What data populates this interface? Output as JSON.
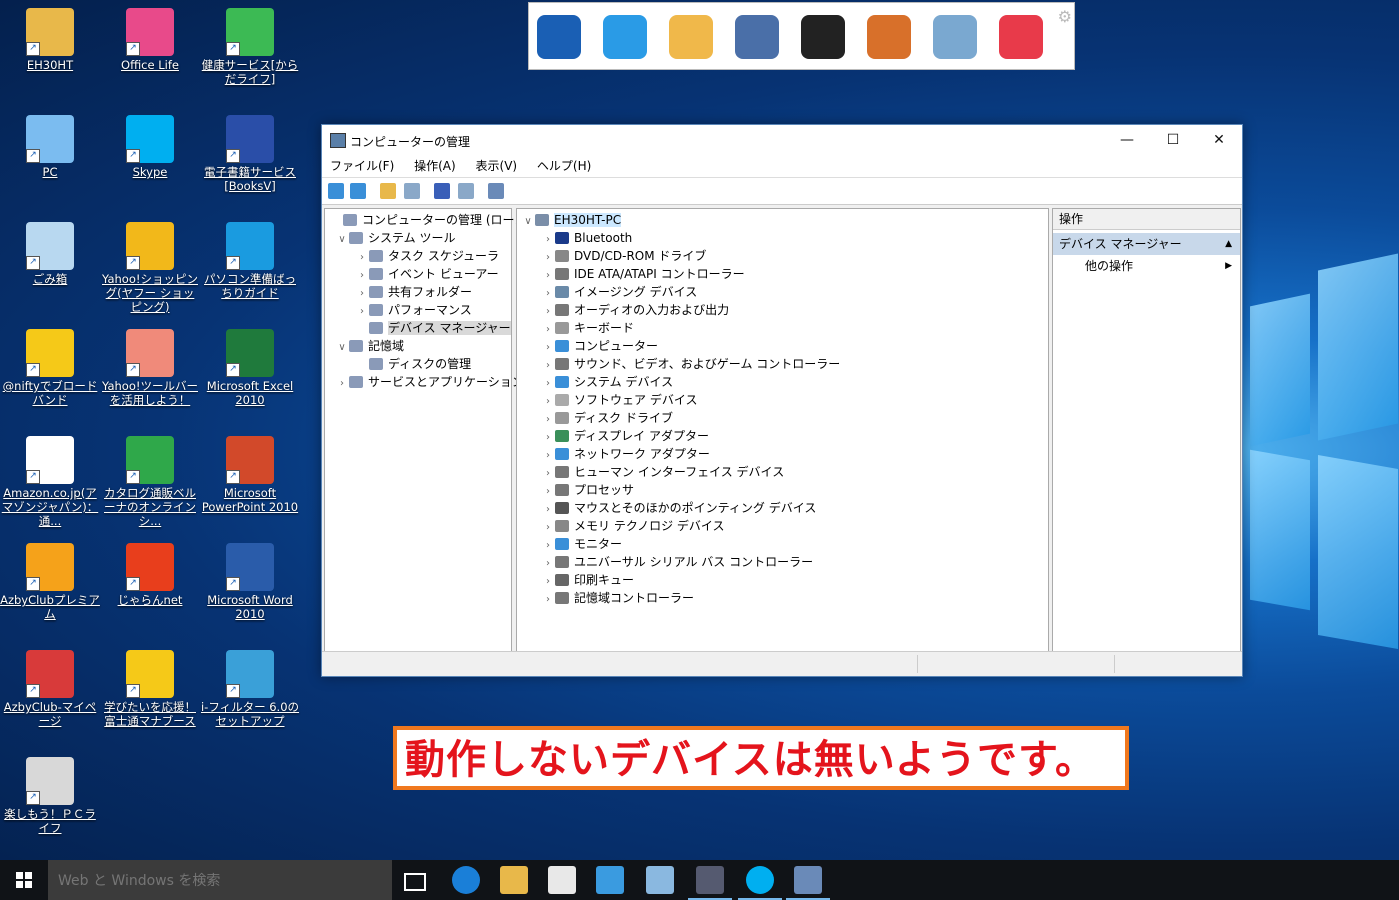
{
  "desktop_icons": [
    {
      "name": "EH30HT",
      "color": "#e8b84a"
    },
    {
      "name": "Office Life",
      "color": "#e84a8a"
    },
    {
      "name": "健康サービス[からだライフ]",
      "color": "#3cba54"
    },
    {
      "name": "PC",
      "color": "#7bbcf0"
    },
    {
      "name": "Skype",
      "color": "#00aff0"
    },
    {
      "name": "電子書籍サービス[BooksV]",
      "color": "#2a4ea8"
    },
    {
      "name": "ごみ箱",
      "color": "#b8d8f0"
    },
    {
      "name": "Yahoo!ショッピング(ヤフー ショッピング)",
      "color": "#f2b81a"
    },
    {
      "name": "パソコン準備ばっちりガイド",
      "color": "#1a9be0"
    },
    {
      "name": "@niftyでブロードバンド",
      "color": "#f5c918"
    },
    {
      "name": "Yahoo!ツールバーを活用しよう！",
      "color": "#f08a7a"
    },
    {
      "name": "Microsoft Excel 2010",
      "color": "#1f7a3c"
    },
    {
      "name": "Amazon.co.jp(アマゾンジャパン)：通...",
      "color": "#ffffff"
    },
    {
      "name": "カタログ通販ベルーナのオンラインシ...",
      "color": "#2fa84a"
    },
    {
      "name": "Microsoft PowerPoint 2010",
      "color": "#d2492a"
    },
    {
      "name": "AzbyClubプレミアム",
      "color": "#f5a21a"
    },
    {
      "name": "じゃらんnet",
      "color": "#e83e1c"
    },
    {
      "name": "Microsoft Word 2010",
      "color": "#2a5caa"
    },
    {
      "name": "AzbyClub-マイページ",
      "color": "#d83a3a"
    },
    {
      "name": "学びたいを応援！富士通マナブース",
      "color": "#f5c918"
    },
    {
      "name": "i-フィルター 6.0のセットアップ",
      "color": "#3aa0d8"
    },
    {
      "name": "楽しもう！ＰＣライフ",
      "color": "#d8d8d8"
    }
  ],
  "quick_launch": [
    {
      "icon": "at-mail-icon",
      "color": "#1a5fb4"
    },
    {
      "icon": "ie-browser-icon",
      "color": "#2a9be6"
    },
    {
      "icon": "mail-envelope-icon",
      "color": "#f0b84a"
    },
    {
      "icon": "pc-settings-icon",
      "color": "#4a6fa8"
    },
    {
      "icon": "dvd-player-icon",
      "color": "#222222"
    },
    {
      "icon": "dictionary-icon",
      "color": "#d8702a"
    },
    {
      "icon": "backup-icon",
      "color": "#7aa8d0"
    },
    {
      "icon": "pc-support-icon",
      "color": "#e83a4a"
    }
  ],
  "window": {
    "title": "コンピューターの管理",
    "minimize": "—",
    "maximize": "☐",
    "close": "✕",
    "menus": [
      "ファイル(F)",
      "操作(A)",
      "表示(V)",
      "ヘルプ(H)"
    ]
  },
  "tree": [
    {
      "label": "コンピューターの管理 (ローカル)",
      "level": 0,
      "chev": "",
      "sel": false
    },
    {
      "label": "システム ツール",
      "level": 1,
      "chev": "∨",
      "sel": false
    },
    {
      "label": "タスク スケジューラ",
      "level": 2,
      "chev": "›",
      "sel": false
    },
    {
      "label": "イベント ビューアー",
      "level": 2,
      "chev": "›",
      "sel": false
    },
    {
      "label": "共有フォルダー",
      "level": 2,
      "chev": "›",
      "sel": false
    },
    {
      "label": "パフォーマンス",
      "level": 2,
      "chev": "›",
      "sel": false
    },
    {
      "label": "デバイス マネージャー",
      "level": 2,
      "chev": "",
      "sel": true
    },
    {
      "label": "記憶域",
      "level": 1,
      "chev": "∨",
      "sel": false
    },
    {
      "label": "ディスクの管理",
      "level": 2,
      "chev": "",
      "sel": false
    },
    {
      "label": "サービスとアプリケーション",
      "level": 1,
      "chev": "›",
      "sel": false
    }
  ],
  "device_root": "EH30HT-PC",
  "devices": [
    "Bluetooth",
    "DVD/CD-ROM ドライブ",
    "IDE ATA/ATAPI コントローラー",
    "イメージング デバイス",
    "オーディオの入力および出力",
    "キーボード",
    "コンピューター",
    "サウンド、ビデオ、およびゲーム コントローラー",
    "システム デバイス",
    "ソフトウェア デバイス",
    "ディスク ドライブ",
    "ディスプレイ アダプター",
    "ネットワーク アダプター",
    "ヒューマン インターフェイス デバイス",
    "プロセッサ",
    "マウスとそのほかのポインティング デバイス",
    "メモリ テクノロジ デバイス",
    "モニター",
    "ユニバーサル シリアル バス コントローラー",
    "印刷キュー",
    "記憶域コントローラー"
  ],
  "actions": {
    "header": "操作",
    "section": "デバイス マネージャー",
    "item": "他の操作"
  },
  "annotation": "動作しないデバイスは無いようです。",
  "taskbar": {
    "search_placeholder": "Web と Windows を検索"
  }
}
